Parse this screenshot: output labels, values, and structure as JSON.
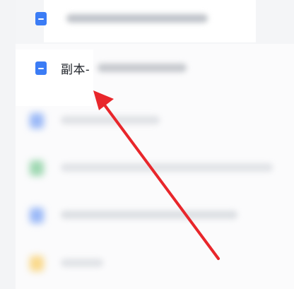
{
  "file_list": {
    "rows": [
      {
        "label": "",
        "icon": "doc-file-icon",
        "icon_color": "#3b7cf5",
        "state": "obscured"
      },
      {
        "label": "副本-",
        "icon": "doc-file-icon",
        "icon_color": "#3b7cf5",
        "state": "highlighted"
      },
      {
        "label": "",
        "icon": "doc-file-icon",
        "icon_color": "#9bb9f7",
        "state": "blurred"
      },
      {
        "label": "",
        "icon": "sheet-file-icon",
        "icon_color": "#9fd8b2",
        "state": "blurred"
      },
      {
        "label": "",
        "icon": "doc-file-icon",
        "icon_color": "#9bb9f7",
        "state": "blurred"
      },
      {
        "label": "",
        "icon": "folder-icon",
        "icon_color": "#f9d98c",
        "state": "blurred"
      }
    ]
  },
  "annotation": {
    "arrow_color": "#e8262b",
    "points_to": "副本-"
  }
}
